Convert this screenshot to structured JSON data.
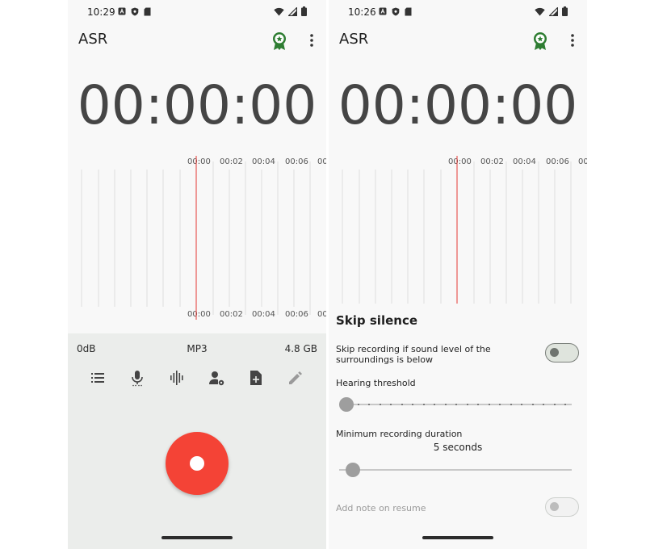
{
  "screens": [
    {
      "status": {
        "time": "10:29"
      },
      "app_title": "ASR",
      "timer": "00:00:00",
      "timeline": {
        "labels": [
          "00:00",
          "00:02",
          "00:04",
          "00:06",
          "00"
        ]
      },
      "info": {
        "level": "0dB",
        "format": "MP3",
        "free_space": "4.8 GB"
      },
      "toolbar_icons": [
        "list-icon",
        "microphone-icon",
        "audio-wave-icon",
        "user-settings-icon",
        "add-file-icon",
        "edit-icon"
      ]
    },
    {
      "status": {
        "time": "10:26"
      },
      "app_title": "ASR",
      "timer": "00:00:00",
      "timeline": {
        "labels": [
          "00:00",
          "00:02",
          "00:04",
          "00:06",
          "00"
        ]
      },
      "sheet": {
        "title": "Skip silence",
        "skip_text": "Skip recording if sound level of the surroundings is below",
        "skip_enabled": false,
        "hearing_threshold_label": "Hearing threshold",
        "hearing_threshold_level": 0.0,
        "min_duration_label": "Minimum recording duration",
        "min_duration_value": "5 seconds",
        "min_duration_level": 0.03,
        "add_note_label": "Add note on resume",
        "add_note_enabled": false
      }
    }
  ],
  "colors": {
    "record": "#f44336",
    "badge": "#2e7d32",
    "playhead": "#e53935"
  }
}
